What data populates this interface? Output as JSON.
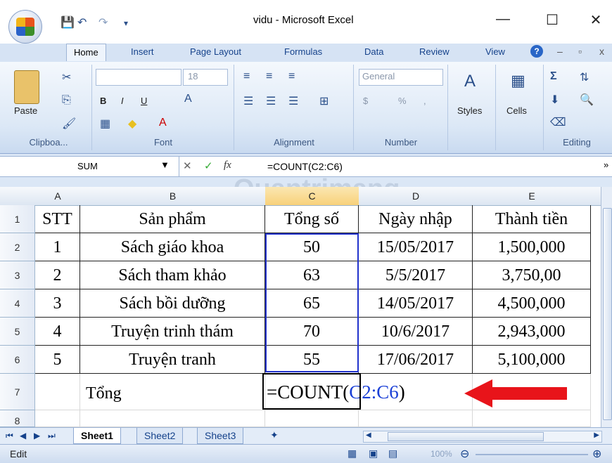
{
  "window": {
    "title": "vidu - Microsoft Excel",
    "minimize": "—",
    "maximize": "☐",
    "close": "✕"
  },
  "ribbon_tabs": [
    "Home",
    "Insert",
    "Page Layout",
    "Formulas",
    "Data",
    "Review",
    "View"
  ],
  "ribbon": {
    "clipboard": {
      "paste_label": "Paste",
      "group": "Clipboa..."
    },
    "font": {
      "size": "18",
      "group": "Font",
      "bold": "B",
      "italic": "I",
      "underline": "U"
    },
    "alignment": {
      "group": "Alignment"
    },
    "number": {
      "format": "General",
      "currency": "$",
      "percent": "%",
      "comma": ",",
      "group": "Number"
    },
    "styles": {
      "label": "Styles"
    },
    "cells": {
      "label": "Cells"
    },
    "editing": {
      "group": "Editing"
    },
    "watermark": "Quantrimang"
  },
  "formula_bar": {
    "name_box": "SUM",
    "fx": "fx",
    "formula": "=COUNT(C2:C6)"
  },
  "columns": [
    "A",
    "B",
    "C",
    "D",
    "E"
  ],
  "rows": [
    "1",
    "2",
    "3",
    "4",
    "5",
    "6",
    "7",
    "8"
  ],
  "table": {
    "header": [
      "STT",
      "Sản phẩm",
      "Tổng số",
      "Ngày nhập",
      "Thành tiền"
    ],
    "rows": [
      [
        "1",
        "Sách giáo khoa",
        "50",
        "15/05/2017",
        "1,500,000"
      ],
      [
        "2",
        "Sách tham khảo",
        "63",
        "5/5/2017",
        "3,750,00"
      ],
      [
        "3",
        "Sách bồi dưỡng",
        "65",
        "14/05/2017",
        "4,500,000"
      ],
      [
        "4",
        "Truyện trinh thám",
        "70",
        "10/6/2017",
        "2,943,000"
      ],
      [
        "5",
        "Truyện tranh",
        "55",
        "17/06/2017",
        "5,100,000"
      ]
    ],
    "total_label": "Tổng",
    "formula_prefix": "=COUNT(",
    "formula_range": "C2:C6",
    "formula_suffix": ")"
  },
  "sheets": [
    "Sheet1",
    "Sheet2",
    "Sheet3"
  ],
  "status": {
    "mode": "Edit",
    "zoom": "100%"
  },
  "colors": {
    "arrow": "#e8141a",
    "range_blue": "#2233cc",
    "range_text": "#1a3fd6"
  }
}
